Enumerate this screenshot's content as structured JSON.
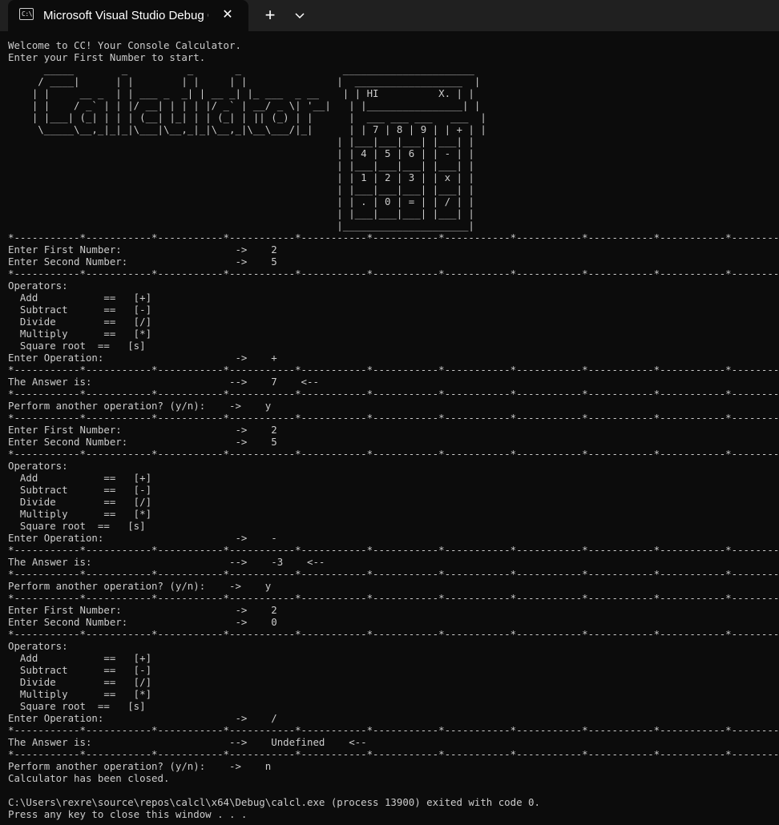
{
  "window": {
    "tab_title": "Microsoft Visual Studio Debug Console",
    "tab_icon": "console-app-icon",
    "tab_icon_text": "C:\\",
    "close_glyph": "✕",
    "new_tab_glyph": "+",
    "dropdown_icon": "chevron-down-icon"
  },
  "console": {
    "lines": [
      "Welcome to CC! Your Console Calculator.",
      "Enter your First Number to start.",
      "      _____        _          _       _                 ______________________",
      "     / ____|      | |        | |     | |               |  __________________  |",
      "    | |     __ _  | | ___ _  _| | __ _| |_ ___  _ __    | | HI          X. | |",
      "    | |    / _` | | |/ __| | | | |/ _` | __/ _ \\| '__|   | |________________| |",
      "    | |___| (_| | | | (__| |_| | | (_| | || (_) | |      |  ___ ___ ___   ___  |",
      "     \\_____\\__,_|_|_|\\___|\\__,_|_|\\__,_|\\__\\___/|_|      | | 7 | 8 | 9 | | + | |",
      "                                                       | |___|___|___| |___| |",
      "                                                       | | 4 | 5 | 6 | | - | |",
      "                                                       | |___|___|___| |___| |",
      "                                                       | | 1 | 2 | 3 | | x | |",
      "                                                       | |___|___|___| |___| |",
      "                                                       | | . | 0 | = | | / | |",
      "                                                       | |___|___|___| |___| |",
      "                                                       |_____________________|",
      "*-----------*-----------*-----------*-----------*-----------*-----------*-----------*-----------*-----------*-----------*-----------*",
      "Enter First Number:                   ->    2",
      "Enter Second Number:                  ->    5",
      "*-----------*-----------*-----------*-----------*-----------*-----------*-----------*-----------*-----------*-----------*-----------*",
      "Operators:",
      "  Add           ==   [+]",
      "  Subtract      ==   [-]",
      "  Divide        ==   [/]",
      "  Multiply      ==   [*]",
      "  Square root  ==   [s]",
      "Enter Operation:                      ->    +",
      "*-----------*-----------*-----------*-----------*-----------*-----------*-----------*-----------*-----------*-----------*-----------*",
      "The Answer is:                       -->    7    <--",
      "*-----------*-----------*-----------*-----------*-----------*-----------*-----------*-----------*-----------*-----------*-----------*",
      "Perform another operation? (y/n):    ->    y",
      "*-----------*-----------*-----------*-----------*-----------*-----------*-----------*-----------*-----------*-----------*-----------*",
      "Enter First Number:                   ->    2",
      "Enter Second Number:                  ->    5",
      "*-----------*-----------*-----------*-----------*-----------*-----------*-----------*-----------*-----------*-----------*-----------*",
      "Operators:",
      "  Add           ==   [+]",
      "  Subtract      ==   [-]",
      "  Divide        ==   [/]",
      "  Multiply      ==   [*]",
      "  Square root  ==   [s]",
      "Enter Operation:                      ->    -",
      "*-----------*-----------*-----------*-----------*-----------*-----------*-----------*-----------*-----------*-----------*-----------*",
      "The Answer is:                       -->    -3    <--",
      "*-----------*-----------*-----------*-----------*-----------*-----------*-----------*-----------*-----------*-----------*-----------*",
      "Perform another operation? (y/n):    ->    y",
      "*-----------*-----------*-----------*-----------*-----------*-----------*-----------*-----------*-----------*-----------*-----------*",
      "Enter First Number:                   ->    2",
      "Enter Second Number:                  ->    0",
      "*-----------*-----------*-----------*-----------*-----------*-----------*-----------*-----------*-----------*-----------*-----------*",
      "Operators:",
      "  Add           ==   [+]",
      "  Subtract      ==   [-]",
      "  Divide        ==   [/]",
      "  Multiply      ==   [*]",
      "  Square root  ==   [s]",
      "Enter Operation:                      ->    /",
      "*-----------*-----------*-----------*-----------*-----------*-----------*-----------*-----------*-----------*-----------*-----------*",
      "The Answer is:                       -->    Undefined    <--",
      "*-----------*-----------*-----------*-----------*-----------*-----------*-----------*-----------*-----------*-----------*-----------*",
      "Perform another operation? (y/n):    ->    n",
      "Calculator has been closed.",
      "",
      "C:\\Users\\rexre\\source\\repos\\calcl\\x64\\Debug\\calcl.exe (process 13900) exited with code 0.",
      "Press any key to close this window . . ."
    ]
  }
}
